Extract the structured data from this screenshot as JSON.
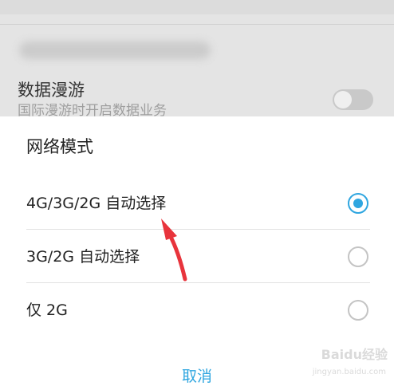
{
  "background": {
    "setting_title": "数据漫游",
    "setting_subtitle": "国际漫游时开启数据业务"
  },
  "dialog": {
    "title": "网络模式",
    "options": [
      {
        "label": "4G/3G/2G 自动选择",
        "selected": true
      },
      {
        "label": "3G/2G 自动选择",
        "selected": false
      },
      {
        "label": "仅 2G",
        "selected": false
      }
    ],
    "cancel_label": "取消"
  },
  "watermark": {
    "main": "Baidu经验",
    "sub": "jingyan.baidu.com"
  },
  "colors": {
    "accent": "#2fa6e0",
    "annotation_arrow": "#e8343c"
  }
}
